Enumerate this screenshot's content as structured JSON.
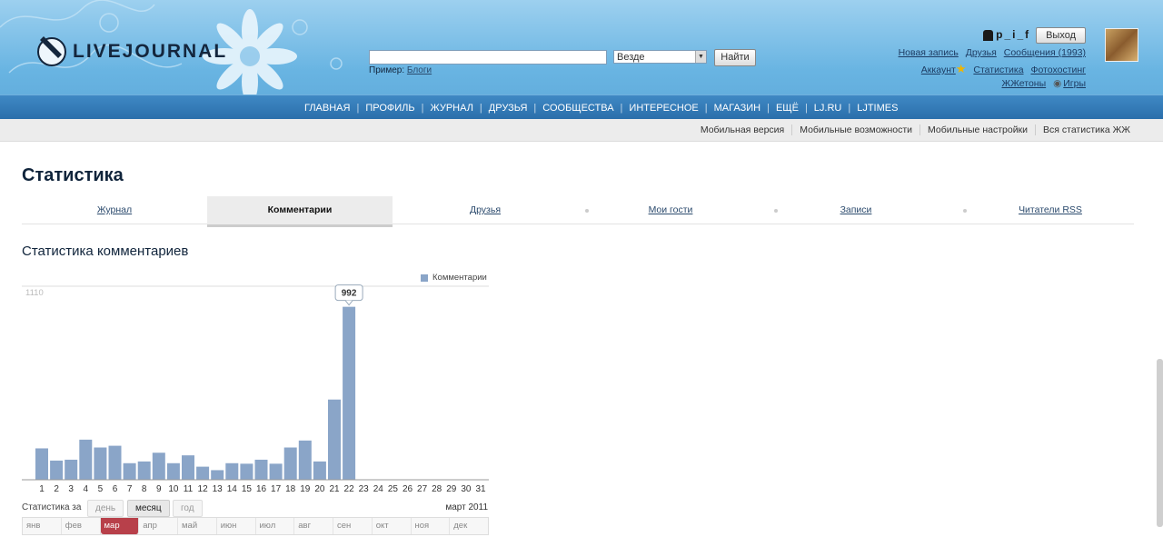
{
  "header": {
    "logo": "LIVEJOURNAL",
    "search": {
      "value": "",
      "scope": "Везде",
      "button": "Найти",
      "example_label": "Пример:",
      "example_link": "Блоги"
    },
    "user": {
      "username": "p_i_f",
      "logout": "Выход",
      "links_row1": [
        "Новая запись",
        "Друзья",
        "Сообщения (1993)"
      ],
      "links_row2": [
        "Аккаунт",
        "Статистика",
        "Фотохостинг"
      ],
      "links_row3": [
        "ЖЖетоны",
        "Игры"
      ]
    },
    "nav": [
      "ГЛАВНАЯ",
      "ПРОФИЛЬ",
      "ЖУРНАЛ",
      "ДРУЗЬЯ",
      "СООБЩЕСТВА",
      "ИНТЕРЕСНОЕ",
      "МАГАЗИН",
      "ЕЩЁ",
      "LJ.RU",
      "LJTIMES"
    ],
    "subnav": [
      "Мобильная версия",
      "Мобильные возможности",
      "Мобильные настройки",
      "Вся статистика ЖЖ"
    ]
  },
  "page": {
    "title": "Статистика",
    "tabs": [
      "Журнал",
      "Комментарии",
      "Друзья",
      "Мои гости",
      "Записи",
      "Читатели RSS"
    ],
    "active_tab": 1,
    "section_title": "Статистика комментариев"
  },
  "chart_data": {
    "type": "bar",
    "categories": [
      "1",
      "2",
      "3",
      "4",
      "5",
      "6",
      "7",
      "8",
      "9",
      "10",
      "11",
      "12",
      "13",
      "14",
      "15",
      "16",
      "17",
      "18",
      "19",
      "20",
      "21",
      "22",
      "23",
      "24",
      "25",
      "26",
      "27",
      "28",
      "29",
      "30",
      "31"
    ],
    "series": [
      {
        "name": "Комментарии",
        "values": [
          180,
          110,
          115,
          230,
          185,
          195,
          95,
          105,
          155,
          95,
          140,
          75,
          55,
          95,
          92,
          115,
          92,
          185,
          225,
          105,
          460,
          992,
          0,
          0,
          0,
          0,
          0,
          0,
          0,
          0,
          0
        ]
      }
    ],
    "ymax_label": "1110",
    "ylim": [
      0,
      1110
    ],
    "highlight": {
      "index": 21,
      "label": "992"
    },
    "color": "#8aa5c8"
  },
  "period": {
    "label": "Статистика за",
    "options": [
      "день",
      "месяц",
      "год"
    ],
    "active": 1,
    "date": "март 2011",
    "months": [
      "янв",
      "фев",
      "мар",
      "апр",
      "май",
      "июн",
      "июл",
      "авг",
      "сен",
      "окт",
      "ноя",
      "дек"
    ],
    "active_month": 2
  }
}
